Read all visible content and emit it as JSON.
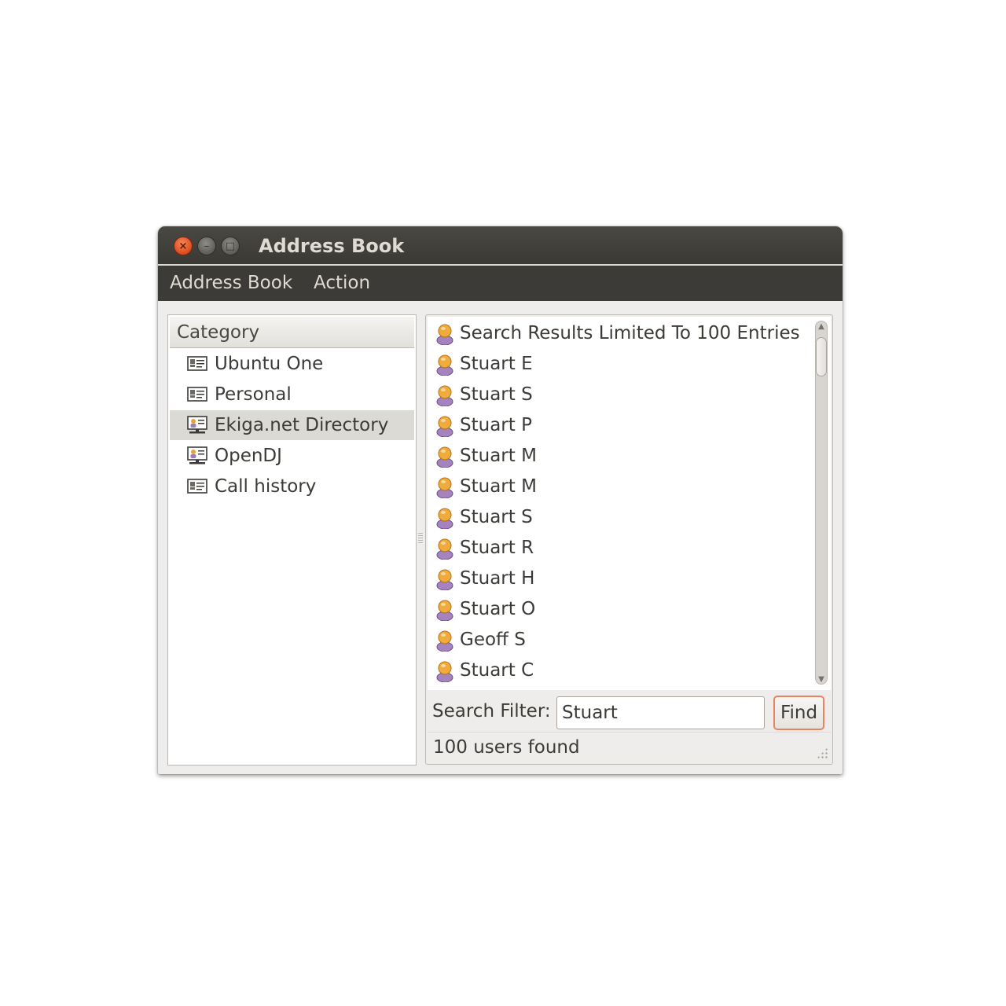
{
  "window": {
    "title": "Address Book"
  },
  "menubar": {
    "items": [
      "Address Book",
      "Action"
    ]
  },
  "categories": {
    "header": "Category",
    "items": [
      {
        "label": "Ubuntu One",
        "icon": "address-card-icon",
        "selected": false
      },
      {
        "label": "Personal",
        "icon": "address-card-icon",
        "selected": false
      },
      {
        "label": "Ekiga.net Directory",
        "icon": "network-directory-icon",
        "selected": true
      },
      {
        "label": "OpenDJ",
        "icon": "network-directory-icon",
        "selected": false
      },
      {
        "label": "Call history",
        "icon": "address-card-icon",
        "selected": false
      }
    ]
  },
  "contacts": {
    "items": [
      "Search Results Limited To 100 Entries",
      "Stuart E",
      "Stuart S",
      "Stuart P",
      "Stuart M",
      "Stuart M",
      "Stuart S",
      "Stuart R",
      "Stuart H",
      "Stuart O",
      "Geoff S",
      "Stuart C"
    ]
  },
  "search": {
    "label": "Search Filter:",
    "value": "Stuart",
    "button": "Find"
  },
  "status": {
    "text": "100 users found"
  },
  "colors": {
    "titlebar": "#3c3b37",
    "close_button": "#de4a1c",
    "focus_ring": "#e9845f",
    "selected_row": "#dcdad5"
  }
}
